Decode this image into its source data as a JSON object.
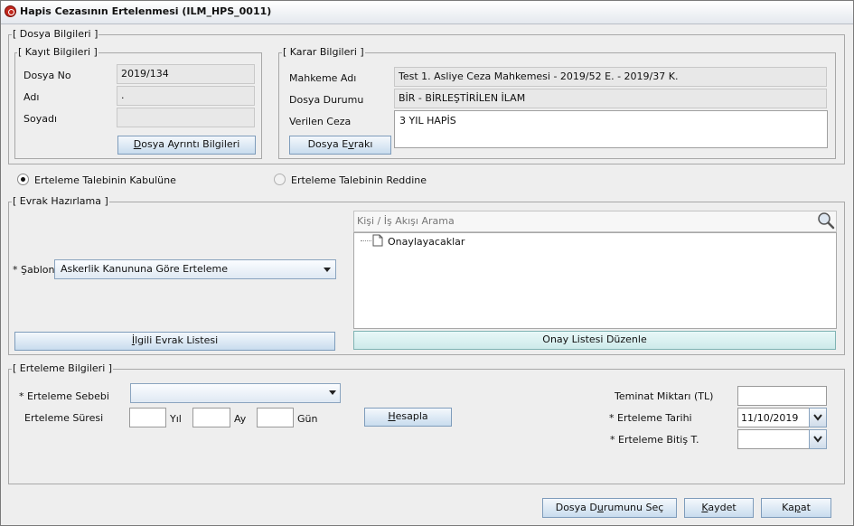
{
  "window": {
    "title": "Hapis Cezasının Ertelenmesi (ILM_HPS_0011)"
  },
  "dosya_bilgileri": {
    "legend": "[ Dosya Bilgileri ]",
    "kayit": {
      "legend": "[ Kayıt Bilgileri ]",
      "dosya_no_label": "Dosya No",
      "dosya_no_value": "2019/134",
      "adi_label": "Adı",
      "adi_value": ".",
      "soyadi_label": "Soyadı",
      "soyadi_value": "",
      "button_pre": "D",
      "button_rest": "osya Ayrıntı Bilgileri"
    },
    "karar": {
      "legend": "[ Karar Bilgileri ]",
      "mahkeme_label": "Mahkeme Adı",
      "mahkeme_value": "Test 1. Asliye Ceza Mahkemesi - 2019/52 E. - 2019/37 K.",
      "durum_label": "Dosya Durumu",
      "durum_value": "BİR - BİRLEŞTİRİLEN İLAM",
      "ceza_label": "Verilen Ceza",
      "ceza_value": "3 YIL HAPİS",
      "button_pre": "Dosya E",
      "button_u": "v",
      "button_rest": "rakı"
    }
  },
  "radios": {
    "kabul_label": "Erteleme Talebinin Kabulüne",
    "ret_label": "Erteleme Talebinin Reddine"
  },
  "evrak": {
    "legend": "[ Evrak Hazırlama ]",
    "sablon_label": "* Şablon",
    "sablon_value": "Askerlik Kanununa Göre Erteleme",
    "ilgili_button_u": "İ",
    "ilgili_button_rest": "lgili Evrak Listesi",
    "search_placeholder": "Kişi / İş Akışı Arama",
    "tree_item": "Onaylayacaklar",
    "onay_button": "Onay Listesi Düzenle"
  },
  "erteleme": {
    "legend": "[ Erteleme Bilgileri ]",
    "sebep_label": "* Erteleme Sebebi",
    "sure_label": "Erteleme Süresi",
    "yil_label": "Yıl",
    "ay_label": "Ay",
    "gun_label": "Gün",
    "hesapla_u": "H",
    "hesapla_rest": "esapla",
    "teminat_label": "Teminat Miktarı (TL)",
    "tarih_label": "* Erteleme Tarihi",
    "tarih_value": "11/10/2019",
    "bitis_label": "* Erteleme Bitiş T."
  },
  "footer": {
    "durum_pre": "Dosya D",
    "durum_u": "u",
    "durum_rest": "rumunu Seç",
    "kaydet_u": "K",
    "kaydet_rest": "aydet",
    "kapat_pre": "Ka",
    "kapat_u": "p",
    "kapat_rest": "at"
  }
}
